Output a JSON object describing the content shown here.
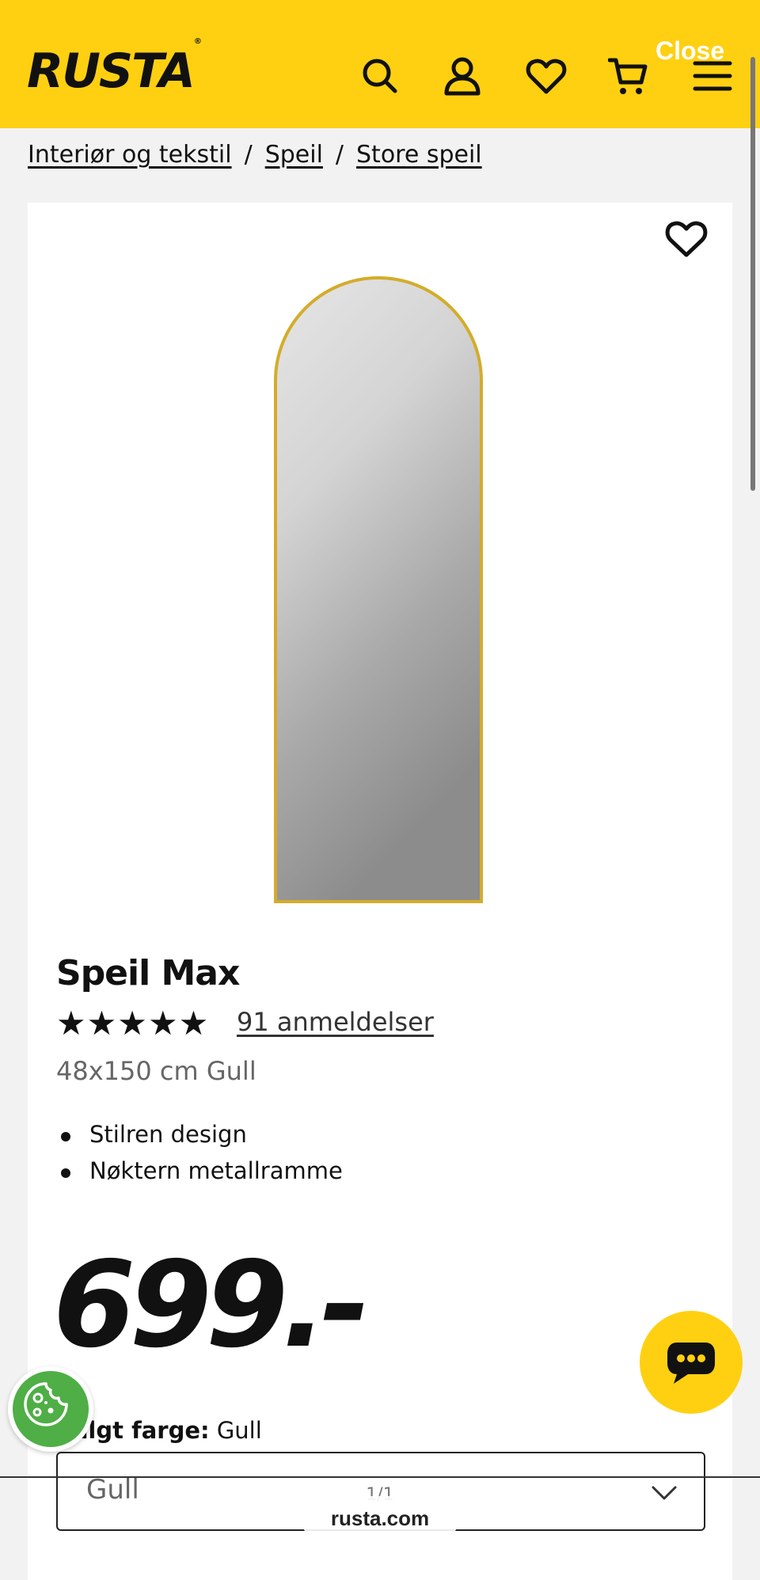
{
  "header": {
    "logo_text": "RUSTA",
    "logo_mark": "®",
    "close_label": "Close",
    "icons": [
      "search-icon",
      "user-icon",
      "heart-icon",
      "cart-icon",
      "menu-icon"
    ],
    "brand_color": "#ffd011"
  },
  "breadcrumb": {
    "items": [
      "Interiør og tekstil",
      "Speil",
      "Store speil"
    ],
    "separator": "/"
  },
  "product": {
    "title": "Speil Max",
    "stars": "★★★★★",
    "rating": 5,
    "reviews_label": "91 anmeldelser",
    "variant": "48x150 cm Gull",
    "features": [
      "Stilren design",
      "Nøktern metallramme"
    ],
    "price": "699.-"
  },
  "color_select": {
    "label_prefix": "Valgt farge:",
    "label_value": "Gull",
    "selected": "Gull"
  },
  "floating": {
    "chat_icon": "chat-icon",
    "cookie_icon": "cookie-icon"
  },
  "browser": {
    "page_count": "1/1",
    "url": "rusta.com"
  }
}
